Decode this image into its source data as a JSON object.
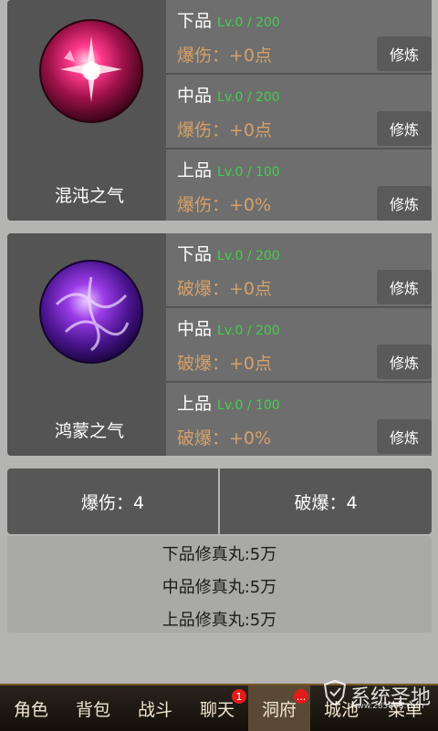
{
  "groups": [
    {
      "name": "混沌之气",
      "rows": [
        {
          "tier": "下品",
          "lv": "Lv.0 / 200",
          "stat": "爆伤：+0点",
          "button": "修炼"
        },
        {
          "tier": "中品",
          "lv": "Lv.0 / 200",
          "stat": "爆伤：+0点",
          "button": "修炼"
        },
        {
          "tier": "上品",
          "lv": "Lv.0 / 100",
          "stat": "爆伤：+0%",
          "button": "修炼"
        }
      ]
    },
    {
      "name": "鸿蒙之气",
      "rows": [
        {
          "tier": "下品",
          "lv": "Lv.0 / 200",
          "stat": "破爆：+0点",
          "button": "修炼"
        },
        {
          "tier": "中品",
          "lv": "Lv.0 / 200",
          "stat": "破爆：+0点",
          "button": "修炼"
        },
        {
          "tier": "上品",
          "lv": "Lv.0 / 100",
          "stat": "破爆：+0%",
          "button": "修炼"
        }
      ]
    }
  ],
  "summary": {
    "crit_damage": "爆伤：4",
    "crit_break": "破爆：4"
  },
  "pills": [
    "下品修真丸:5万",
    "中品修真丸:5万",
    "上品修真丸:5万"
  ],
  "nav": [
    {
      "label": "角色"
    },
    {
      "label": "背包"
    },
    {
      "label": "战斗"
    },
    {
      "label": "聊天",
      "badge": "1"
    },
    {
      "label": "洞府",
      "badge": "..."
    },
    {
      "label": "城池"
    },
    {
      "label": "菜单"
    }
  ],
  "watermark": {
    "text": "系统圣地",
    "url": "www.285868.com"
  },
  "colors": {
    "level": "#3fd24a",
    "stat": "#d5a06a",
    "badge": "#e21b1b"
  }
}
